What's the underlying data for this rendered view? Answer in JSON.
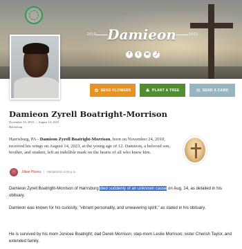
{
  "hero": {
    "name": "Damieon",
    "birth_year": "2010",
    "death_year": "2023",
    "socials": [
      {
        "icon": "facebook-icon",
        "glyph": "f"
      },
      {
        "icon": "twitter-icon",
        "glyph": "t"
      },
      {
        "icon": "email-icon",
        "glyph": "✉"
      },
      {
        "icon": "share-icon",
        "glyph": "⤴"
      }
    ]
  },
  "actions": {
    "send_flowers": "SEND FLOWERS",
    "plant_tree": "PLANT A TREE",
    "send_card": "SEND A CARD"
  },
  "obituary": {
    "full_name": "Damieon Zyrell Boatright-Morrison",
    "dates": "November 24, 2010 — August 14, 2023",
    "location": "Harrisburg",
    "bio_prefix": "Harrisburg, PA - ",
    "bio_name": "Damieon Zyrell Boatright-Morrison",
    "bio_rest": ", born on November 24, 2010, received his wings on August 14, 2023, at the young age of 12. Damieon, a beloved son, brother, and student, left an indelible mark on the hearts of all who knew him."
  },
  "author": {
    "name": "Jillian Pikora",
    "separator": "|",
    "date": "08/26/2023 4:00 p.m."
  },
  "article": {
    "p1_before": "Damieon Zyrell Boatright-Morrison of Harrisburg ",
    "p1_highlight": "died suddenly of an unknown cause",
    "p1_after": " on Aug. 14, as detailed in his obituary.",
    "p2": "Damieon was known for his curiosity, \"vibrant personality, and unwavering spirit,\" as stated in his obituary.",
    "p3": "He is survived by his mom Jonicee Boatright; dad Derek Morrison; step-mom Leslie Morrison; sister Cherish Taylor, and extended family."
  },
  "colors": {
    "flowers": "#e79225",
    "tree": "#4f8d2f",
    "card": "#97b4c1",
    "highlight": "#3b74d6",
    "author": "#c0392b"
  }
}
